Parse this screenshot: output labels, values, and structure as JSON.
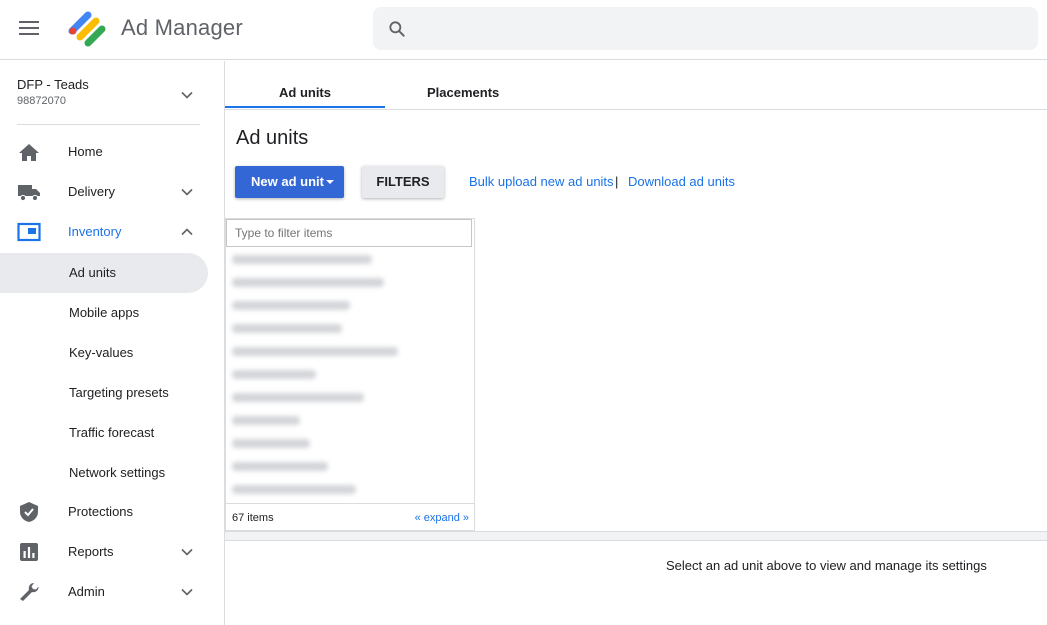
{
  "app": {
    "title": "Ad Manager"
  },
  "network": {
    "name": "DFP - Teads",
    "id": "98872070"
  },
  "nav": {
    "home": "Home",
    "delivery": "Delivery",
    "inventory": "Inventory",
    "inventory_sub": [
      "Ad units",
      "Mobile apps",
      "Key-values",
      "Targeting presets",
      "Traffic forecast",
      "Network settings"
    ],
    "protections": "Protections",
    "reports": "Reports",
    "admin": "Admin"
  },
  "tabs": [
    "Ad units",
    "Placements"
  ],
  "page_title": "Ad units",
  "toolbar": {
    "new_ad_unit": "New ad unit",
    "filters": "FILTERS",
    "bulk_upload": "Bulk upload new ad units",
    "separator": "|",
    "download": "Download ad units"
  },
  "tree": {
    "filter_placeholder": "Type to filter items",
    "count": "67 items",
    "expand": "« expand »"
  },
  "empty_message": "Select an ad unit above to view and manage its settings",
  "colors": {
    "primary": "#3367d6",
    "link": "#1a73e8",
    "selected_bg": "#e8eaed"
  }
}
